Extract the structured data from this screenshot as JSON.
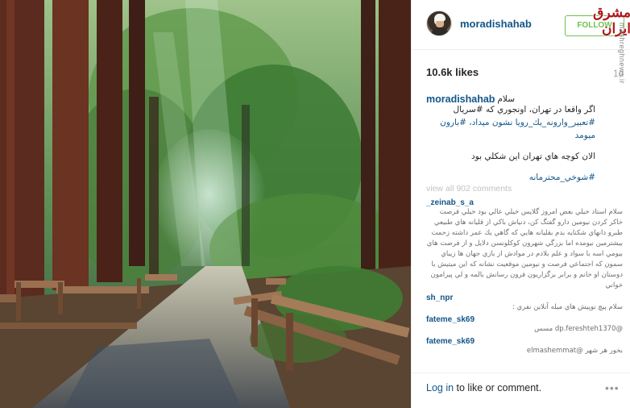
{
  "post": {
    "username": "moradishahab",
    "follow_label": "FOLLOW",
    "likes": "10.6k likes",
    "time_ago": "1d",
    "watermark": "مشرق ایران",
    "watermark_side": "mashreghnews.ir",
    "caption": {
      "greeting": "سلام",
      "line1": "اگر واقعا در تهران، اونجوري كه #سريال",
      "line2": "#تعبير_وارونه_يك_رويا نشون ميداد، #بارون ميومد",
      "line3": "الان كوچه هاي تهران اين شكلي بود",
      "line4": "#شوخي_محترمانه"
    },
    "view_all": "view all 902 comments",
    "comments": [
      {
        "user": "_zeinab_s_a",
        "text": "سلام استاد خيلي بعض امروز گلايس خيلي عالي بود خيلي فرصت خاكر كردن نيومين دارو گفتگ كن، دنياش باكي از قليانه هاي طبيعي طبرو دانهاي شكنايه بدم بقليانه هايي كه گاهي يك عمر داشته زحمت بيشترمين نيومده اما بزرگي شهرون كوكلونسن دلايل و از فرصت هاي بيومي اسه با سواد و علم بلادم در موادش از بازي جهان ها زيباي سمون كه اجتماعي فرصت و نيومين موقعيت نشانه كه اين ميتيش با دوستان او خانم و برابر برگزاريون فرون رسانش بالمه و لي پيرامون خواني"
      },
      {
        "user": "sh_npr",
        "text": "سلام پيچ نوپيش هاي ميله آنلاين نفري :"
      },
      {
        "user": "fateme_sk69",
        "text": "@dp.fereshteh1370 مسس"
      },
      {
        "user": "fateme_sk69",
        "text": "بخور هر شهر @elmashemmat"
      }
    ],
    "login_link": "Log in",
    "login_rest": " to like or comment.",
    "more_label": "•••"
  },
  "colors": {
    "link_blue": "#125688",
    "follow_green": "#70c050",
    "watermark_red": "#b0161a"
  }
}
